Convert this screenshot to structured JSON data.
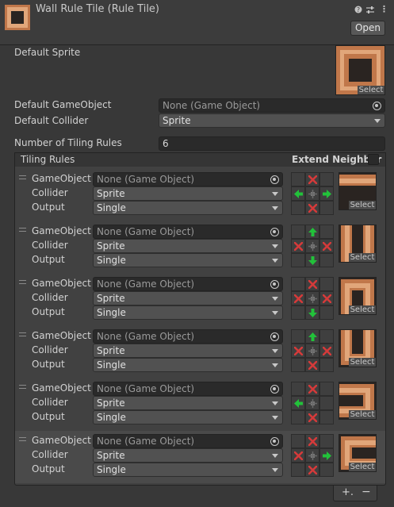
{
  "header": {
    "title": "Wall Rule Tile (Rule Tile)",
    "open_label": "Open",
    "help_glyph": "❓",
    "settings_glyph": "⇄",
    "menu_glyph": "⋮"
  },
  "default_sprite": {
    "label": "Default Sprite",
    "select_label": "Select"
  },
  "default_gameobject": {
    "label": "Default GameObject",
    "value": "None (Game Object)"
  },
  "default_collider": {
    "label": "Default Collider",
    "value": "Sprite"
  },
  "number_of_rules": {
    "label": "Number of Tiling Rules",
    "value": "6"
  },
  "tiling_rules": {
    "header": "Tiling Rules",
    "extend_neighbor_label": "Extend Neighbor",
    "gameobject_label": "GameObject",
    "collider_label": "Collider",
    "output_label": "Output",
    "rules": [
      {
        "gameobject": "None (Game Object)",
        "collider": "Sprite",
        "output": "Single",
        "select_label": "Select",
        "neighbors": [
          "",
          "x",
          "",
          "left",
          "center",
          "right",
          "",
          "x",
          ""
        ],
        "preview": "top-border"
      },
      {
        "gameobject": "None (Game Object)",
        "collider": "Sprite",
        "output": "Single",
        "select_label": "Select",
        "neighbors": [
          "",
          "up",
          "",
          "x",
          "center",
          "x",
          "",
          "down",
          ""
        ],
        "preview": "vertical-walls"
      },
      {
        "gameobject": "None (Game Object)",
        "collider": "Sprite",
        "output": "Single",
        "select_label": "Select",
        "neighbors": [
          "",
          "x",
          "",
          "x",
          "center",
          "x",
          "",
          "down",
          ""
        ],
        "preview": "cap-top"
      },
      {
        "gameobject": "None (Game Object)",
        "collider": "Sprite",
        "output": "Single",
        "select_label": "Select",
        "neighbors": [
          "",
          "up",
          "",
          "x",
          "center",
          "x",
          "",
          "x",
          ""
        ],
        "preview": "cap-bottom"
      },
      {
        "gameobject": "None (Game Object)",
        "collider": "Sprite",
        "output": "Single",
        "select_label": "Select",
        "neighbors": [
          "",
          "x",
          "",
          "left",
          "center",
          "",
          "",
          "x",
          ""
        ],
        "preview": "end-right"
      },
      {
        "gameobject": "None (Game Object)",
        "collider": "Sprite",
        "output": "Single",
        "select_label": "Select",
        "neighbors": [
          "",
          "x",
          "",
          "x",
          "center",
          "right",
          "",
          "x",
          ""
        ],
        "preview": "end-left"
      }
    ]
  },
  "footer": {
    "add_label": "+.",
    "remove_label": "−"
  },
  "colors": {
    "tile_light": "#e1a67a",
    "tile_mid": "#c0774a",
    "tile_dark": "#2a2421",
    "arrow_green": "#22c23a",
    "x_red": "#d43a3a"
  }
}
